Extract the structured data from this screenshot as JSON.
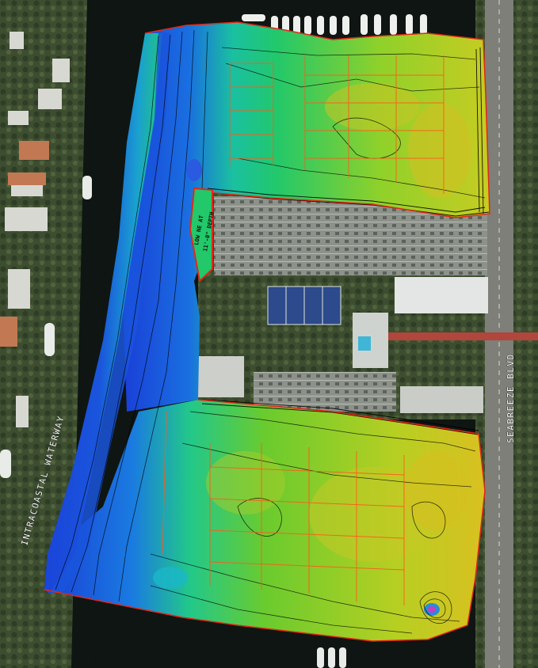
{
  "map": {
    "labels": {
      "waterway": "INTRACOASTAL WATERWAY",
      "boulevard": "SEABREEZE BLVD",
      "note_line1": "LOW NE AT",
      "note_line2": "11'-0\" DEPTH"
    },
    "colors": {
      "deep": "#1a3fd8",
      "mid_deep": "#1aa0d0",
      "mid": "#22c86a",
      "shallow": "#8fd12a",
      "shoal": "#d9c020",
      "contour": "#000000",
      "slip_outline": "#ff5a1a",
      "water": "#0f1512",
      "land": "#4a5a3c",
      "road": "#8a8a84",
      "parking": "#9aa096"
    }
  }
}
